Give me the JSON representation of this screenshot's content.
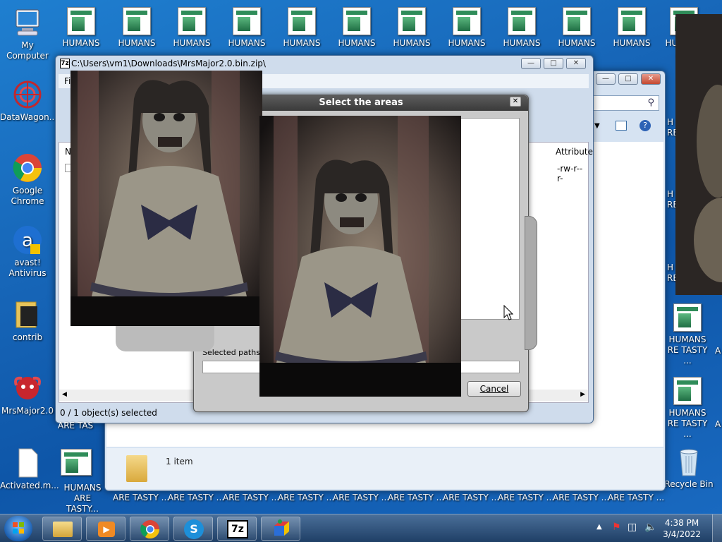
{
  "desktop": {
    "left_icons": [
      {
        "label": "My Computer"
      },
      {
        "label": "DataWagon..."
      },
      {
        "label": "Google Chrome"
      },
      {
        "label": "avast! Antivirus"
      },
      {
        "label": "contrib"
      },
      {
        "label": "MrsMajor2.0"
      },
      {
        "label": "Activated.m..."
      }
    ],
    "top_icons": [
      "HUMANS",
      "HUMANS",
      "HUMANS",
      "HUMANS",
      "HUMANS",
      "HUMANS",
      "HUMANS",
      "HUMANS",
      "HUMANS",
      "HUMANS",
      "HUMANS"
    ],
    "top_icon_far_right": "HUMANS ARE",
    "bottom_row_labels": [
      "HUMANS ARE TASTY...",
      "ARE TASTY ...",
      "ARE TASTY ...",
      "ARE TASTY ...",
      "ARE TASTY ...",
      "ARE TASTY ...",
      "ARE TASTY ...",
      "ARE TASTY ...",
      "ARE TASTY ...",
      "ARE TASTY ...",
      "ARE TASTY ...",
      "ARE TASTY ..."
    ],
    "right_col": [
      {
        "label": "H RE"
      },
      {
        "label": "H RE"
      },
      {
        "label": "H RE"
      },
      {
        "label": "HUMANS RE TASTY ...",
        "trail": "A"
      },
      {
        "label": "HUMANS RE TASTY ...",
        "trail": "A"
      }
    ],
    "recycle_bin": "Recycle Bin"
  },
  "sevenzip_window": {
    "title": "C:\\Users\\vm1\\Downloads\\MrsMajor2.0.bin.zip\\",
    "menu_first": "Fi",
    "col_name": "N",
    "col_attributes": "Attribute",
    "row_attr": "-rw-r--r-",
    "status": "0 / 1 object(s) selected",
    "tail_label": "ARE TAS"
  },
  "explorer_window": {
    "status": "1 item"
  },
  "dialog": {
    "title": "Select the areas",
    "selected_paths_label": "Selected paths:",
    "cancel_label": "Cancel"
  },
  "taskbar": {
    "time": "4:38 PM",
    "date": "3/4/2022",
    "sevenzip_label": "7z"
  }
}
